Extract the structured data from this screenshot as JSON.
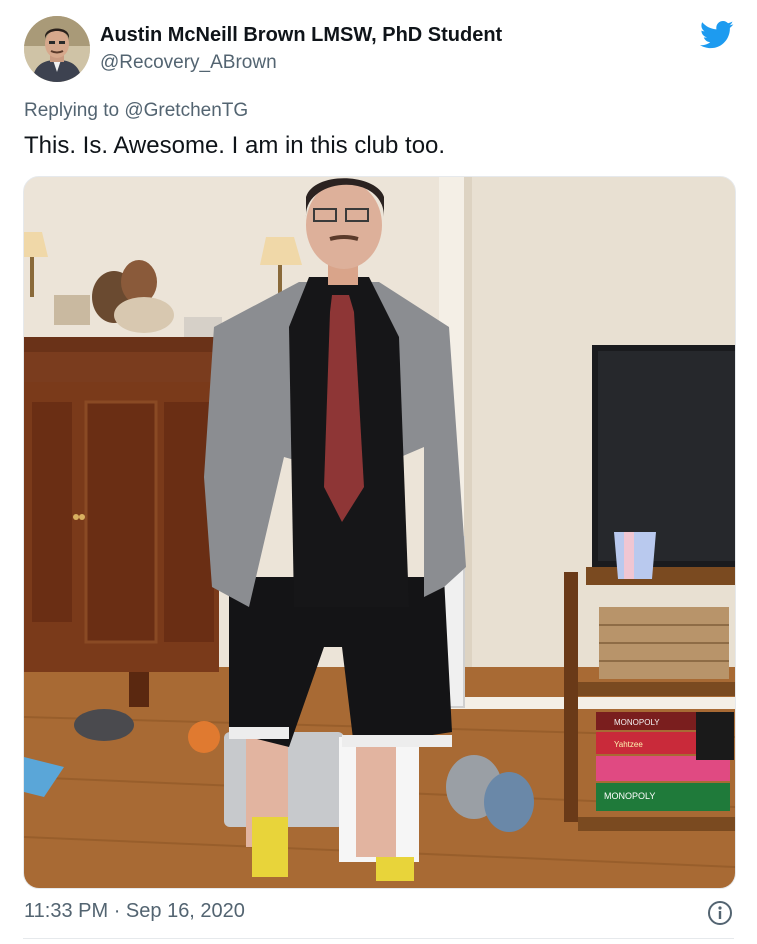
{
  "tweet": {
    "author": {
      "name": "Austin McNeill Brown LMSW, PhD Student",
      "handle": "@Recovery_ABrown"
    },
    "replying_prefix": "Replying to",
    "replying_to": "@GretchenTG",
    "text": "This. Is. Awesome. I am in this club too.",
    "time": "11:33 PM",
    "separator": "·",
    "date": "Sep 16, 2020"
  },
  "photo_box_labels": {
    "top": "MONOPOLY",
    "second": "Yahtzee",
    "bottom": "MONOPOLY"
  },
  "icons": {
    "brand": "twitter-bird-icon",
    "info": "info-icon"
  },
  "colors": {
    "brand": "#1d9bf0",
    "text": "#0f1419",
    "secondary": "#536471"
  }
}
